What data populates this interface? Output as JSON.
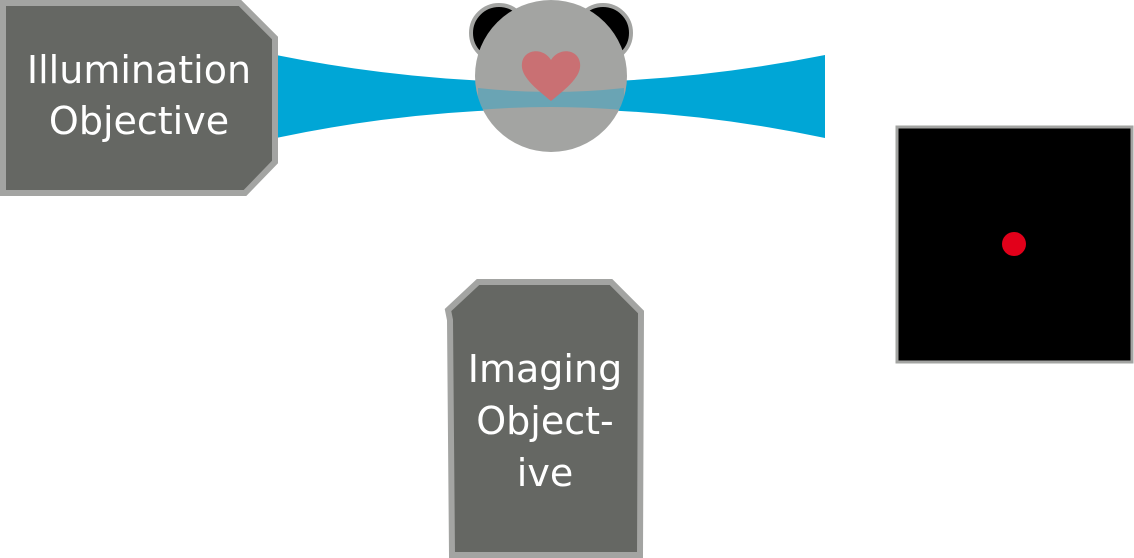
{
  "illumination_objective": {
    "label_line1": "Illumination",
    "label_line2": "Objective"
  },
  "imaging_objective": {
    "label_line1": "Imaging",
    "label_line2": "Object-",
    "label_line3": "ive"
  },
  "colors": {
    "objective_fill": "#656763",
    "objective_border": "#a3a4a2",
    "light_sheet": "#00a6d6",
    "sample_body": "#a3a4a2",
    "sample_eyes": "#000000",
    "sample_heart": "#c97073",
    "camera_bg": "#000000",
    "camera_border": "#a3a4a2",
    "detected_spot": "#e2001a"
  },
  "icons": {
    "sample": "panda-face-with-heart-icon",
    "spot": "red-dot-icon"
  }
}
